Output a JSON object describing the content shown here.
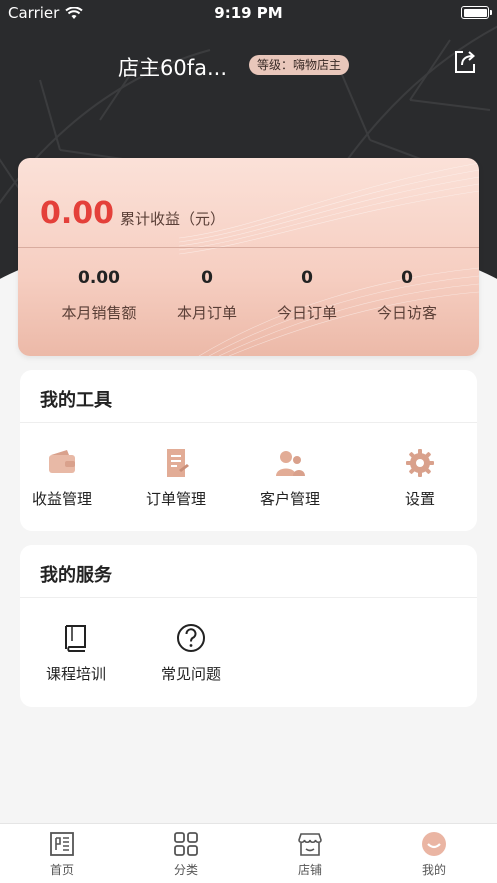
{
  "status_bar": {
    "carrier": "Carrier",
    "time": "9:19 PM"
  },
  "profile": {
    "shop_name": "店主60fa...",
    "level_badge": "等级：嗨物店主"
  },
  "earnings": {
    "total_amount": "0.00",
    "total_label": "累计收益（元）",
    "stats": [
      {
        "value": "0.00",
        "label": "本月销售额"
      },
      {
        "value": "0",
        "label": "本月订单"
      },
      {
        "value": "0",
        "label": "今日订单"
      },
      {
        "value": "0",
        "label": "今日访客"
      }
    ]
  },
  "tools": {
    "title": "我的工具",
    "items": [
      {
        "label": "收益管理",
        "icon": "wallet-icon"
      },
      {
        "label": "订单管理",
        "icon": "order-document-icon"
      },
      {
        "label": "客户管理",
        "icon": "customers-icon"
      },
      {
        "label": "设置",
        "icon": "gear-icon"
      }
    ]
  },
  "services": {
    "title": "我的服务",
    "items": [
      {
        "label": "课程培训",
        "icon": "book-icon"
      },
      {
        "label": "常见问题",
        "icon": "question-icon"
      }
    ]
  },
  "tabbar": {
    "items": [
      {
        "label": "首页",
        "icon": "home-icon"
      },
      {
        "label": "分类",
        "icon": "category-grid-icon"
      },
      {
        "label": "店铺",
        "icon": "store-icon"
      },
      {
        "label": "我的",
        "icon": "profile-smile-icon"
      }
    ]
  },
  "colors": {
    "accent_red": "#e4403a",
    "header_dark": "#2a2b2d",
    "tool_icon": "#d9a18c"
  }
}
